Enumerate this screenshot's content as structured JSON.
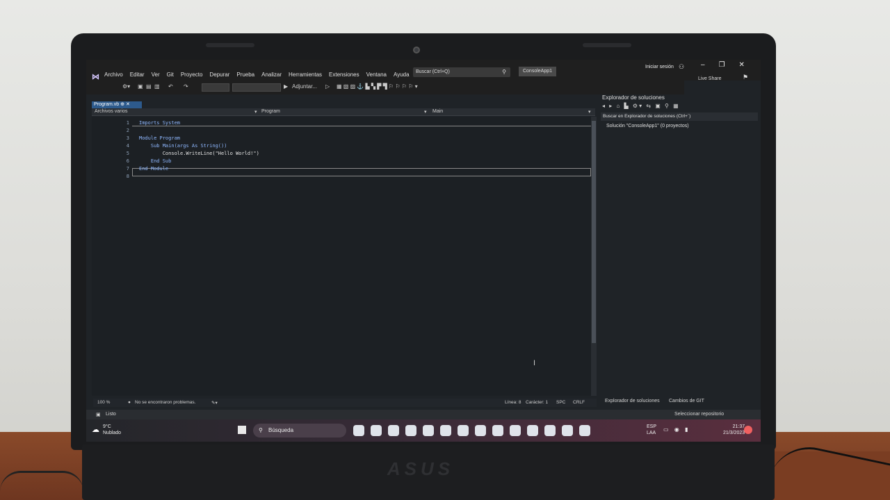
{
  "app": {
    "menu": [
      "Archivo",
      "Editar",
      "Ver",
      "Git",
      "Proyecto",
      "Depurar",
      "Prueba",
      "Analizar",
      "Herramientas",
      "Extensiones",
      "Ventana",
      "Ayuda"
    ],
    "search_placeholder": "Buscar (Ctrl+Q)",
    "project_badge": "ConsoleApp1",
    "login": "Iniciar sesión",
    "live_share": "Live Share",
    "toolbar_attach": "Adjuntar..."
  },
  "editor": {
    "tab": "Program.vb",
    "nav_files": "Archivos varios",
    "nav_class": "Program",
    "nav_member": "Main",
    "line_numbers": [
      "1",
      "2",
      "3",
      "4",
      "5",
      "6",
      "7",
      "8"
    ],
    "lines": [
      "Imports System",
      "",
      "Module Program",
      "    Sub Main(args As String())",
      "        Console.WriteLine(\"Hello World!\")",
      "    End Sub",
      "End Module",
      ""
    ],
    "status": {
      "zoom": "100 %",
      "problems": "No se encontraron problemas.",
      "line": "Línea: 8",
      "char": "Carácter: 1",
      "spc": "SPC",
      "crlf": "CRLF"
    }
  },
  "solution_explorer": {
    "title": "Explorador de soluciones",
    "search": "Buscar en Explorador de soluciones (Ctrl+`)",
    "item": "Solución \"ConsoleApp1\" (0 proyectos)",
    "tab_active": "Explorador de soluciones",
    "tab_git": "Cambios de GIT"
  },
  "statusbar": {
    "ready": "Listo",
    "repo": "Seleccionar repositorio"
  },
  "taskbar": {
    "temp": "9°C",
    "weather": "Nublado",
    "search": "Búsqueda",
    "lang": "ESP",
    "lang2": "LAA",
    "time": "21:37",
    "date": "21/3/2023"
  }
}
